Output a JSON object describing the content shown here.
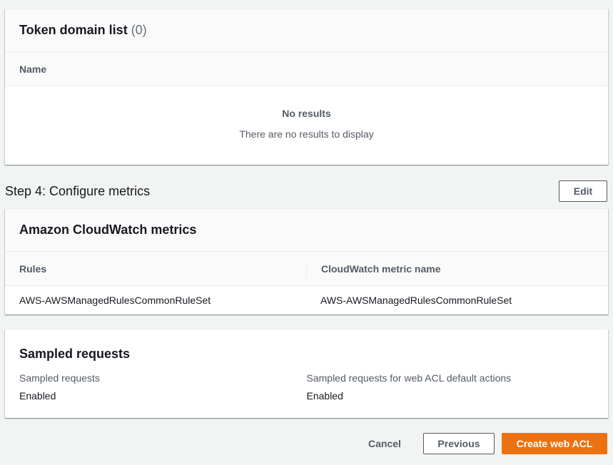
{
  "token_domain": {
    "title": "Token domain list",
    "count": "(0)",
    "column_name": "Name",
    "empty_title": "No results",
    "empty_text": "There are no results to display"
  },
  "step4": {
    "heading": "Step 4: Configure metrics",
    "edit_label": "Edit"
  },
  "cloudwatch": {
    "title": "Amazon CloudWatch metrics",
    "columns": [
      "Rules",
      "CloudWatch metric name"
    ],
    "rows": [
      [
        "AWS-AWSManagedRulesCommonRuleSet",
        "AWS-AWSManagedRulesCommonRuleSet"
      ]
    ]
  },
  "sampled": {
    "title": "Sampled requests",
    "items": [
      {
        "label": "Sampled requests",
        "value": "Enabled"
      },
      {
        "label": "Sampled requests for web ACL default actions",
        "value": "Enabled"
      }
    ]
  },
  "footer": {
    "cancel_label": "Cancel",
    "previous_label": "Previous",
    "create_label": "Create web ACL"
  },
  "colors": {
    "primary": "#ec7211",
    "background": "#f2f3f3",
    "header_bg": "#fafafa"
  }
}
